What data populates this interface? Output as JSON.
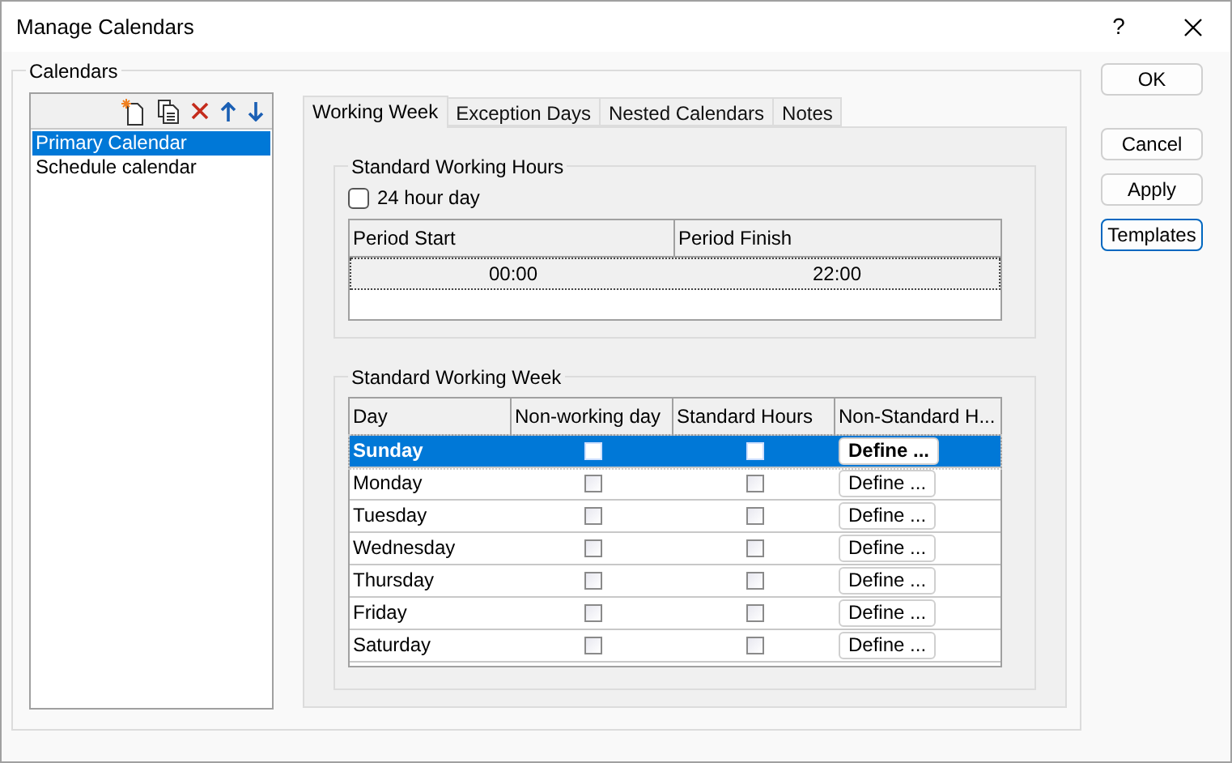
{
  "window": {
    "title": "Manage Calendars",
    "help": "?"
  },
  "calendars": {
    "label": "Calendars",
    "items": [
      {
        "name": "Primary Calendar",
        "selected": true
      },
      {
        "name": "Schedule calendar",
        "selected": false
      }
    ]
  },
  "tabs": [
    {
      "label": "Working Week",
      "selected": true
    },
    {
      "label": "Exception Days",
      "selected": false
    },
    {
      "label": "Nested Calendars",
      "selected": false
    },
    {
      "label": "Notes",
      "selected": false
    }
  ],
  "hours": {
    "label": "Standard Working Hours",
    "day24": {
      "label": "24 hour day",
      "checked": false
    },
    "columns": [
      "Period Start",
      "Period Finish"
    ],
    "rows": [
      [
        "00:00",
        "22:00"
      ]
    ]
  },
  "week": {
    "label": "Standard Working Week",
    "columns": [
      "Day",
      "Non-working day",
      "Standard Hours",
      "Non-Standard H..."
    ],
    "rows": [
      {
        "day": "Sunday",
        "non_working": false,
        "standard": false,
        "button": "Define ...",
        "selected": true
      },
      {
        "day": "Monday",
        "non_working": false,
        "standard": false,
        "button": "Define ...",
        "selected": false
      },
      {
        "day": "Tuesday",
        "non_working": false,
        "standard": false,
        "button": "Define ...",
        "selected": false
      },
      {
        "day": "Wednesday",
        "non_working": false,
        "standard": false,
        "button": "Define ...",
        "selected": false
      },
      {
        "day": "Thursday",
        "non_working": false,
        "standard": false,
        "button": "Define ...",
        "selected": false
      },
      {
        "day": "Friday",
        "non_working": false,
        "standard": false,
        "button": "Define ...",
        "selected": false
      },
      {
        "day": "Saturday",
        "non_working": false,
        "standard": false,
        "button": "Define ...",
        "selected": false
      }
    ]
  },
  "buttons": [
    {
      "label": "OK",
      "focused": false
    },
    {
      "label": "Cancel",
      "focused": false
    },
    {
      "label": "Apply",
      "focused": false
    },
    {
      "label": "Templates",
      "focused": true
    }
  ]
}
